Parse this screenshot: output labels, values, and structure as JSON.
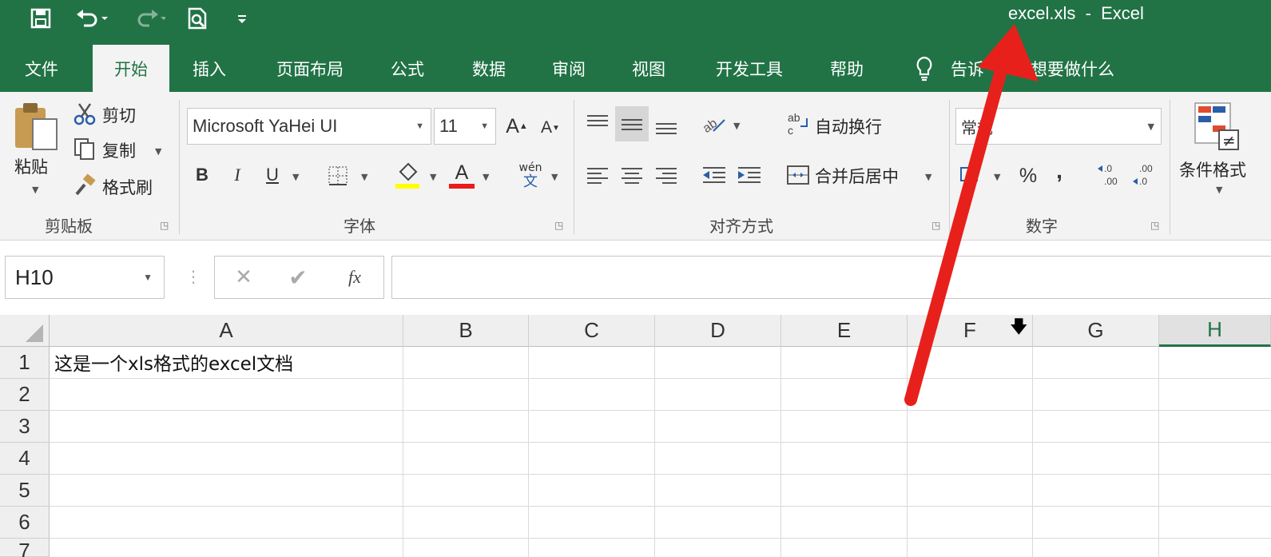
{
  "window": {
    "title": "excel.xls  -  Excel"
  },
  "colors": {
    "accent": "#217346",
    "annotation_arrow": "#e8201c"
  },
  "quick_access": [
    "save-icon",
    "undo-icon",
    "redo-icon",
    "print-preview-icon",
    "customize-qat-icon"
  ],
  "tabs": [
    {
      "label": "文件",
      "active": false
    },
    {
      "label": "开始",
      "active": true
    },
    {
      "label": "插入",
      "active": false
    },
    {
      "label": "页面布局",
      "active": false
    },
    {
      "label": "公式",
      "active": false
    },
    {
      "label": "数据",
      "active": false
    },
    {
      "label": "审阅",
      "active": false
    },
    {
      "label": "视图",
      "active": false
    },
    {
      "label": "开发工具",
      "active": false
    },
    {
      "label": "帮助",
      "active": false
    }
  ],
  "tell_me": {
    "icon": "lightbulb-icon",
    "text_left": "告诉",
    "text_right": "想要做什么"
  },
  "ribbon": {
    "clipboard": {
      "group_label": "剪贴板",
      "paste": "粘贴",
      "cut": "剪切",
      "copy": "复制",
      "format_painter": "格式刷"
    },
    "font": {
      "group_label": "字体",
      "font_name": "Microsoft YaHei UI",
      "font_size": "11",
      "bold": "B",
      "italic": "I",
      "underline": "U",
      "font_color_glyph": "A",
      "phonetic_top": "wén",
      "phonetic_bottom": "文"
    },
    "alignment": {
      "group_label": "对齐方式",
      "wrap_text": "自动换行",
      "merge_center": "合并后居中"
    },
    "number": {
      "group_label": "数字",
      "format": "常规",
      "percent": "%",
      "comma": ","
    },
    "styles": {
      "conditional_format": "条件格式"
    }
  },
  "formula_bar": {
    "name_box": "H10",
    "formula": "",
    "fx": "fx"
  },
  "sheet": {
    "columns": [
      "A",
      "B",
      "C",
      "D",
      "E",
      "F",
      "G",
      "H"
    ],
    "selected_column": "H",
    "rows": [
      "1",
      "2",
      "3",
      "4",
      "5",
      "6",
      "7"
    ],
    "cell_A1": "这是一个xls格式的excel文档"
  }
}
